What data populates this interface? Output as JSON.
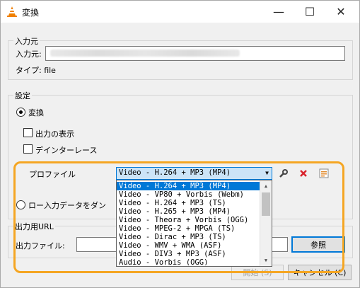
{
  "window": {
    "title": "変換",
    "minimize": "—",
    "maximize": "☐",
    "close": "✕"
  },
  "input_group": {
    "legend": "入力元",
    "source_label": "入力元:",
    "type_label": "タイプ: file"
  },
  "settings_group": {
    "legend": "設定",
    "convert_radio": "変換",
    "show_output_checkbox": "出力の表示",
    "deinterlace_checkbox": "デインターレース",
    "profile_label": "プロファイル",
    "profile_selected": "Video - H.264 + MP3 (MP4)",
    "profile_options": [
      "Video - H.264 + MP3 (MP4)",
      "Video - VP80 + Vorbis (Webm)",
      "Video - H.264 + MP3 (TS)",
      "Video - H.265 + MP3 (MP4)",
      "Video - Theora + Vorbis (OGG)",
      "Video - MPEG-2 + MPGA (TS)",
      "Video - Dirac + MP3 (TS)",
      "Video - WMV + WMA (ASF)",
      "Video - DIV3 + MP3 (ASF)",
      "Audio - Vorbis (OGG)"
    ],
    "raw_dump_radio": "ロー入力データをダン"
  },
  "output_group": {
    "legend": "出力用URL",
    "file_label": "出力ファイル:",
    "browse_button": "参照"
  },
  "footer": {
    "start_button": "開始 (S)",
    "cancel_button": "キャンセル (C)"
  },
  "colors": {
    "highlight": "#f5a623",
    "selection": "#0078d7",
    "delete_icon": "#d9232d"
  }
}
